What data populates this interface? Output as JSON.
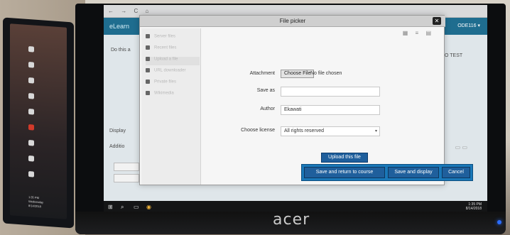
{
  "browser": {
    "nav_glyphs": "← → C ⌂",
    "site_name": "eLearn",
    "user_name": "ODE116 ▾"
  },
  "underlay": {
    "do_this": "Do this a",
    "display_label": "Display",
    "additional_label": "Additio",
    "right_text": "O TEST"
  },
  "dialog": {
    "title": "File picker",
    "close_glyph": "✕",
    "view_icons": "▦ ≡ ▤",
    "repositories": [
      {
        "label": "Server files",
        "icon": "folder-icon"
      },
      {
        "label": "Recent files",
        "icon": "clock-icon"
      },
      {
        "label": "Upload a file",
        "icon": "upload-icon"
      },
      {
        "label": "URL downloader",
        "icon": "link-icon"
      },
      {
        "label": "Private files",
        "icon": "user-icon"
      },
      {
        "label": "Wikimedia",
        "icon": "globe-icon"
      }
    ],
    "form": {
      "attachment_label": "Attachment",
      "choose_file_label": "Choose File",
      "no_file_text": "No file chosen",
      "save_as_label": "Save as",
      "save_as_value": "",
      "author_label": "Author",
      "author_value": "Ekawati",
      "license_label": "Choose license",
      "license_value": "All rights reserved"
    },
    "upload_button": "Upload this file"
  },
  "actions": {
    "save_return": "Save and return to course",
    "save_display": "Save and display",
    "cancel": "Cancel"
  },
  "taskbar": {
    "start_glyph": "⊞",
    "search_glyph": "⌕",
    "task_glyph": "▭",
    "browser_glyph": "◉",
    "time": "1:35 PM",
    "date": "8/14/2018"
  },
  "laptop": {
    "time": "1:35 PM",
    "day": "Wednesday",
    "date": "8/14/2018"
  },
  "monitor_brand": "acer",
  "colors": {
    "accent": "#1f5f9c",
    "highlight": "#1a78b8",
    "header": "#1f6d8f"
  }
}
